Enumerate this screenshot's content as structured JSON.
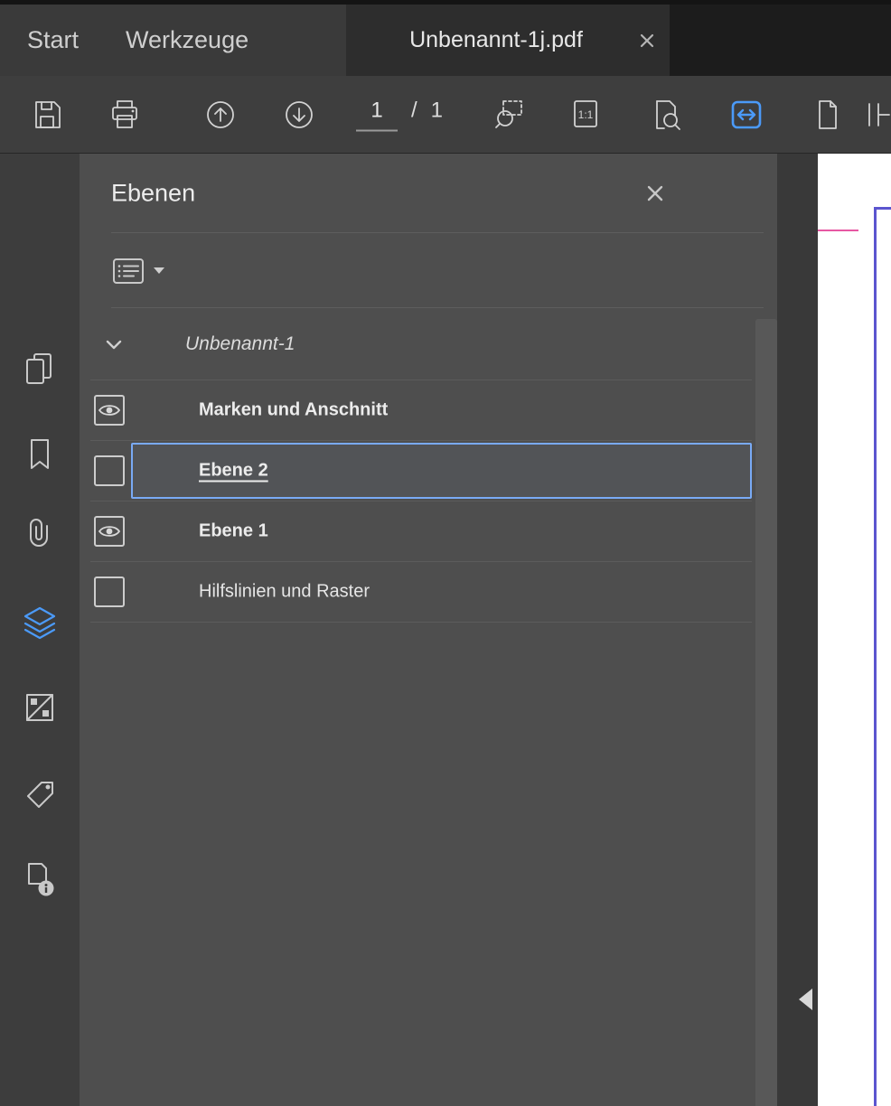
{
  "tabbar": {
    "start_label": "Start",
    "tools_label": "Werkzeuge",
    "document_tab": "Unbenannt-1j.pdf"
  },
  "toolbar": {
    "page_current": "1",
    "page_separator": "/",
    "page_total": "1",
    "actual_size_label": "1:1"
  },
  "layers_panel": {
    "title": "Ebenen",
    "root_label": "Unbenannt-1",
    "items": [
      {
        "label": "Marken und Anschnitt",
        "visible": true,
        "selected": false
      },
      {
        "label": "Ebene 2",
        "visible": false,
        "selected": true
      },
      {
        "label": "Ebene 1",
        "visible": true,
        "selected": false
      },
      {
        "label": "Hilfslinien und Raster",
        "visible": false,
        "selected": false
      }
    ]
  },
  "colors": {
    "accent_blue": "#4b9af8",
    "selection_border": "#79aaf5",
    "page_border": "#5b55cf",
    "bleed_mark": "#e757a3"
  }
}
